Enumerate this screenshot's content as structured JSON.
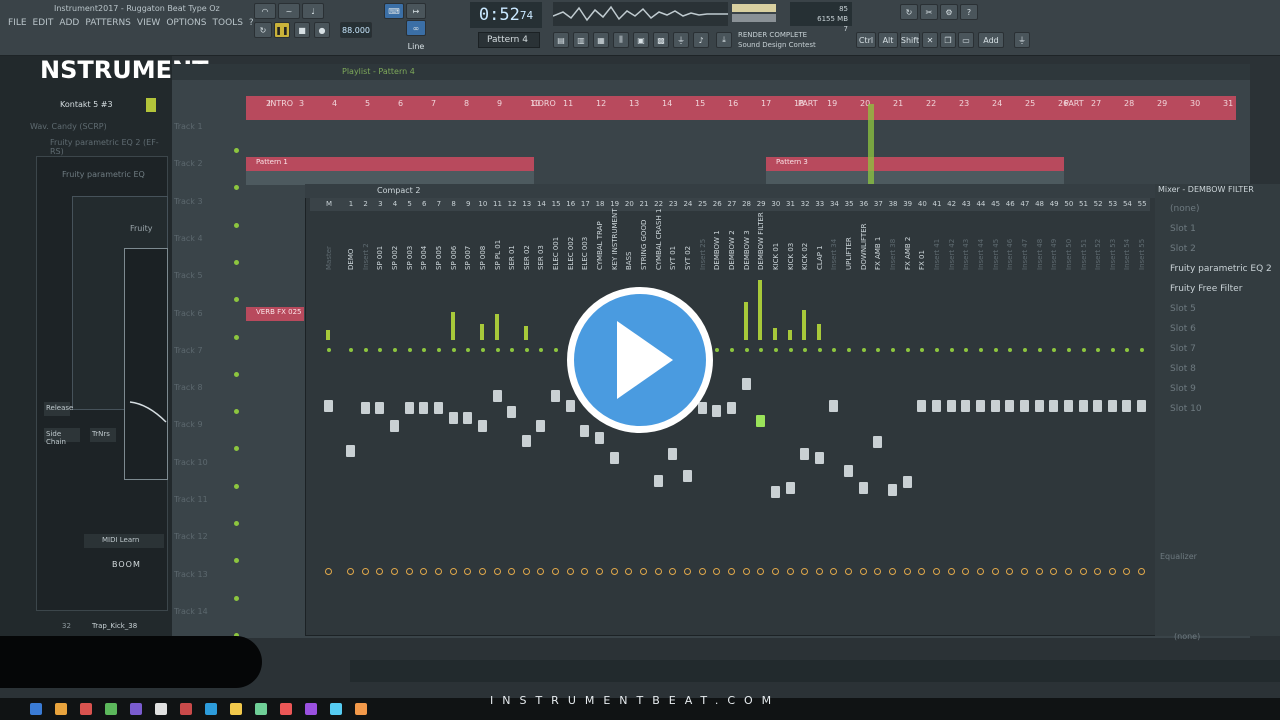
{
  "app": {
    "title": "Instrument2017 - Ruggaton Beat Type Oz",
    "menu": [
      "FILE",
      "EDIT",
      "ADD",
      "PATTERNS",
      "VIEW",
      "OPTIONS",
      "TOOLS",
      "?"
    ],
    "logo": "NSTRUMENT",
    "footer_url": "INSTRUMENTBEAT.COM"
  },
  "transport": {
    "tempo": "88.000",
    "time_main": "0:52",
    "time_sub": "74",
    "pattern": "Pattern 4",
    "snap": "Line"
  },
  "status": {
    "render": "RENDER COMPLETE",
    "hint": "Sound Design Contest",
    "memory": "6155 MB",
    "cpu": "7",
    "mem_top": "85"
  },
  "toolbar_keys": [
    "Ctrl",
    "Alt",
    "Shift",
    "Add"
  ],
  "playlist": {
    "title": "Playlist - Pattern 4",
    "ruler": [
      "2",
      "3",
      "4",
      "5",
      "6",
      "7",
      "8",
      "9",
      "10",
      "11",
      "12",
      "13",
      "14",
      "15",
      "16",
      "17",
      "18",
      "19",
      "20",
      "21",
      "22",
      "23",
      "24",
      "25",
      "26",
      "27",
      "28",
      "29",
      "30",
      "31"
    ],
    "markers": [
      "INTRO",
      "CORO",
      "PART",
      "PART"
    ],
    "tracks": [
      "Track 1",
      "Track 2",
      "Track 3",
      "Track 4",
      "Track 5",
      "Track 6",
      "Track 7",
      "Track 8",
      "Track 9",
      "Track 10",
      "Track 11",
      "Track 12",
      "Track 13",
      "Track 14"
    ],
    "clips": [
      "Pattern 1",
      "Pattern 3",
      "VERB FX 025"
    ]
  },
  "left_panel": {
    "plugin": "Kontakt 5 #3",
    "chain1": "Wav. Candy (SCRP)",
    "chain2": "Fruity parametric EQ 2 (EF-RS)",
    "chain3": "Fruity parametric EQ",
    "chain4": "Fruity",
    "btn_release": "Release",
    "btn_sidechain": "Side Chain",
    "btn_trnrs": "TrNrs",
    "midi": "MIDI Learn",
    "boom": "BOOM",
    "bottom_channel": "Trap_Kick_38",
    "bottom_num": "32"
  },
  "mixer": {
    "title": "Mixer - DEMBOW FILTER",
    "view": "Compact 2",
    "channels": [
      {
        "n": "M",
        "name": "Master"
      },
      {
        "n": "1",
        "name": "DEMO"
      },
      {
        "n": "2",
        "name": "Insert 2"
      },
      {
        "n": "3",
        "name": "SP 001"
      },
      {
        "n": "4",
        "name": "SP 002"
      },
      {
        "n": "5",
        "name": "SP 003"
      },
      {
        "n": "6",
        "name": "SP 004"
      },
      {
        "n": "7",
        "name": "SP 005"
      },
      {
        "n": "8",
        "name": "SP 006"
      },
      {
        "n": "9",
        "name": "SP 007"
      },
      {
        "n": "10",
        "name": "SP 008"
      },
      {
        "n": "11",
        "name": "SP PL 01"
      },
      {
        "n": "12",
        "name": "SER 01"
      },
      {
        "n": "13",
        "name": "SER 02"
      },
      {
        "n": "14",
        "name": "SER 03"
      },
      {
        "n": "15",
        "name": "ELEC 001"
      },
      {
        "n": "16",
        "name": "ELEC 002"
      },
      {
        "n": "17",
        "name": "ELEC 003"
      },
      {
        "n": "18",
        "name": "CYMBAL TRAP"
      },
      {
        "n": "19",
        "name": "KEY INSTRUMENT"
      },
      {
        "n": "20",
        "name": "BASS"
      },
      {
        "n": "21",
        "name": "STRING GOOD"
      },
      {
        "n": "22",
        "name": "CYMBAL CRASH 1"
      },
      {
        "n": "23",
        "name": "SYT 01"
      },
      {
        "n": "24",
        "name": "SYT 02"
      },
      {
        "n": "25",
        "name": "Insert 25"
      },
      {
        "n": "26",
        "name": "DEMBOW 1"
      },
      {
        "n": "27",
        "name": "DEMBOW 2"
      },
      {
        "n": "28",
        "name": "DEMBOW 3"
      },
      {
        "n": "29",
        "name": "DEMBOW FILTER"
      },
      {
        "n": "30",
        "name": "KICK 01"
      },
      {
        "n": "31",
        "name": "KICK 03"
      },
      {
        "n": "32",
        "name": "KICK 02"
      },
      {
        "n": "33",
        "name": "CLAP 1"
      },
      {
        "n": "34",
        "name": "Insert 34"
      },
      {
        "n": "35",
        "name": "UPLIFTER"
      },
      {
        "n": "36",
        "name": "DOWNLIFTER"
      },
      {
        "n": "37",
        "name": "FX AMB 1"
      },
      {
        "n": "38",
        "name": "Insert 38"
      },
      {
        "n": "39",
        "name": "FX AMB 2"
      },
      {
        "n": "40",
        "name": "FX 01"
      },
      {
        "n": "41",
        "name": "Insert 41"
      },
      {
        "n": "42",
        "name": "Insert 42"
      },
      {
        "n": "43",
        "name": "Insert 43"
      },
      {
        "n": "44",
        "name": "Insert 44"
      },
      {
        "n": "45",
        "name": "Insert 45"
      },
      {
        "n": "46",
        "name": "Insert 46"
      },
      {
        "n": "47",
        "name": "Insert 47"
      },
      {
        "n": "48",
        "name": "Insert 48"
      },
      {
        "n": "49",
        "name": "Insert 49"
      },
      {
        "n": "50",
        "name": "Insert 50"
      },
      {
        "n": "51",
        "name": "Insert 51"
      },
      {
        "n": "52",
        "name": "Insert 52"
      },
      {
        "n": "53",
        "name": "Insert 53"
      },
      {
        "n": "54",
        "name": "Insert 54"
      },
      {
        "n": "55",
        "name": "Insert 55"
      }
    ],
    "fx_slots": [
      "(none)",
      "Slot 1",
      "Slot 2",
      "Fruity parametric EQ 2",
      "Fruity Free Filter",
      "Slot 5",
      "Slot 6",
      "Slot 7",
      "Slot 8",
      "Slot 9",
      "Slot 10"
    ],
    "eq_label": "Equalizer",
    "out_label": "(none)"
  },
  "colors": {
    "accent": "#8dc63f",
    "ruler": "#b84a5d",
    "play": "#4a9be0"
  }
}
